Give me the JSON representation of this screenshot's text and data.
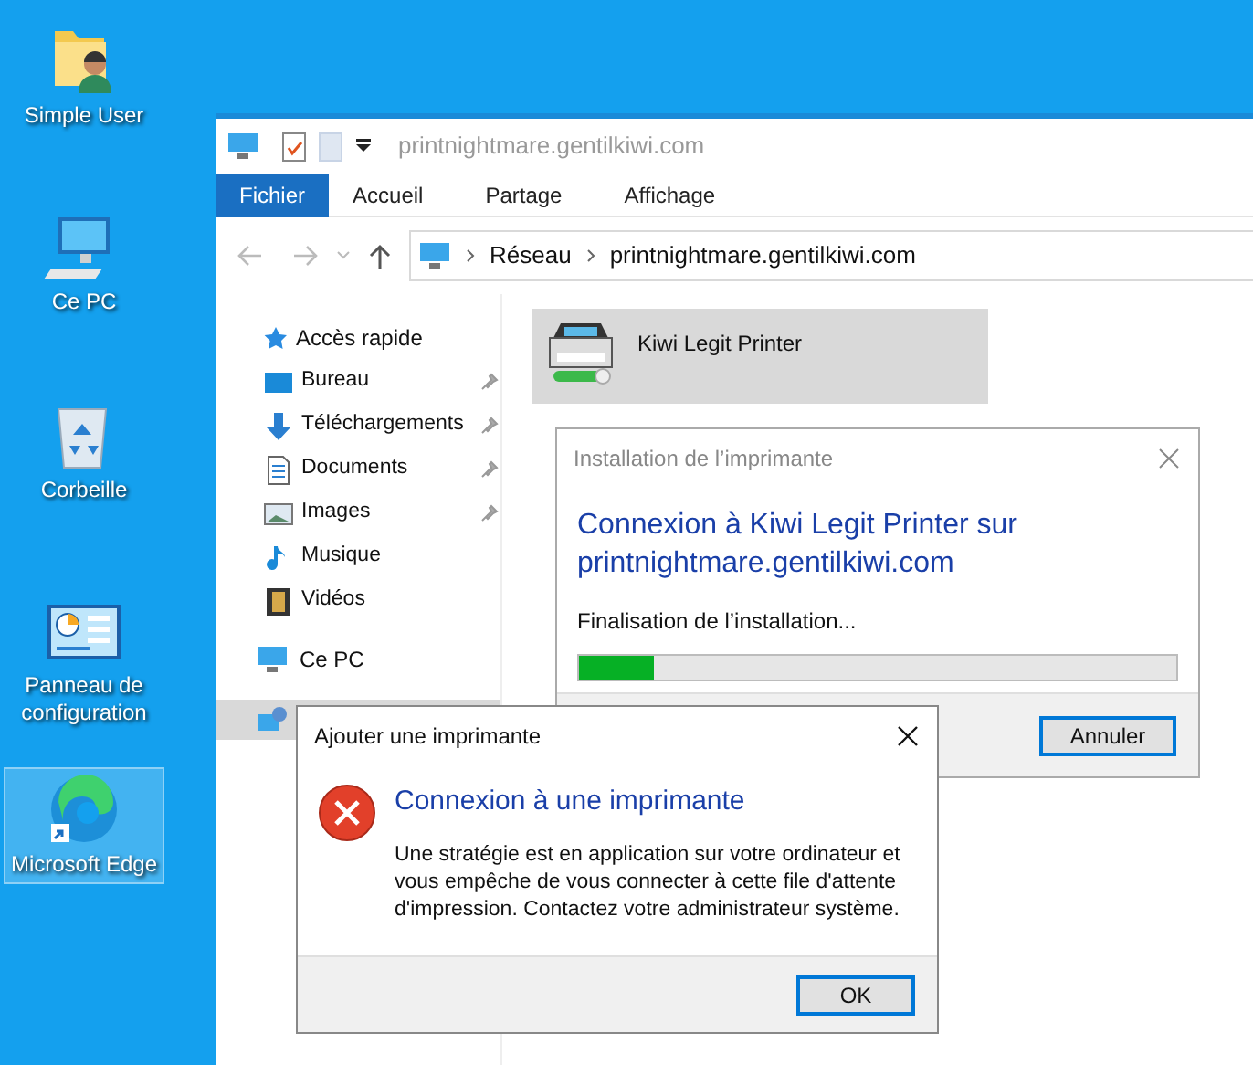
{
  "desktop_icons": [
    {
      "kind": "user-folder",
      "label": "Simple User",
      "selected": false
    },
    {
      "kind": "computer",
      "label": "Ce PC",
      "selected": false
    },
    {
      "kind": "bin",
      "label": "Corbeille",
      "selected": false
    },
    {
      "kind": "panel",
      "label": "Panneau de configuration",
      "selected": false
    },
    {
      "kind": "edge",
      "label": "Microsoft Edge",
      "selected": true
    }
  ],
  "explorer": {
    "title": "printnightmare.gentilkiwi.com",
    "ribbon_tabs": [
      {
        "label": "Fichier",
        "selected": true
      },
      {
        "label": "Accueil",
        "selected": false
      },
      {
        "label": "Partage",
        "selected": false
      },
      {
        "label": "Affichage",
        "selected": false
      }
    ],
    "breadcrumb": [
      "Réseau",
      "printnightmare.gentilkiwi.com"
    ],
    "sidebar": {
      "quick_access": "Accès rapide",
      "items": [
        {
          "kind": "desktop",
          "label": "Bureau",
          "pinned": true
        },
        {
          "kind": "download",
          "label": "Téléchargements",
          "pinned": true
        },
        {
          "kind": "document",
          "label": "Documents",
          "pinned": true
        },
        {
          "kind": "image",
          "label": "Images",
          "pinned": true
        },
        {
          "kind": "music",
          "label": "Musique",
          "pinned": false
        },
        {
          "kind": "video",
          "label": "Vidéos",
          "pinned": false
        }
      ],
      "this_pc": "Ce PC",
      "network_row": {
        "selected": true
      }
    },
    "items": [
      {
        "label": "Kiwi Legit Printer",
        "selected": true
      }
    ]
  },
  "install_dialog": {
    "title": "Installation de l’imprimante",
    "heading": "Connexion à Kiwi Legit Printer sur printnightmare.gentilkiwi.com",
    "status": "Finalisation de l’installation...",
    "level": 0.125,
    "button": "Annuler"
  },
  "error_dialog": {
    "title": "Ajouter une imprimante",
    "heading": "Connexion à une imprimante",
    "message": "Une stratégie est en application sur votre ordinateur et vous empêche de vous connecter à cette file d'attente d'impression. Contactez votre administrateur système.",
    "button": "OK"
  }
}
